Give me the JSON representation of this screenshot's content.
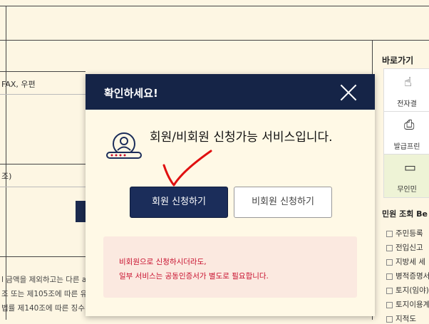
{
  "background": {
    "texts": [
      "FAX, 우편",
      "조)",
      "l 금액을 제외하고는 다른 a",
      "조 또는 제105조에 따른 유여",
      "법률 제140조에 따른 징수"
    ]
  },
  "right_panel": {
    "title": "바로가기",
    "items": [
      {
        "label": "전자결",
        "icon": "cursor-icon"
      },
      {
        "label": "발급프린",
        "icon": "printer-icon"
      },
      {
        "label": "무인민",
        "icon": "kiosk-icon"
      }
    ],
    "section_title": "민원 조회 Be",
    "list": [
      "주민등록",
      "전입신고",
      "지방세 세",
      "병적증명서",
      "토지(임야)",
      "토지이용계",
      "지적도"
    ]
  },
  "modal": {
    "title": "확인하세요!",
    "message": "회원/비회원 신청가능 서비스입니다.",
    "member_button": "회원 신청하기",
    "nonmember_button": "비회원 신청하기",
    "notice_line1": "비회원으로 신청하시더라도,",
    "notice_line2": "일부 서비스는 공동인증서가 별도로 필요합니다.",
    "colors": {
      "header": "#152447",
      "primary_button": "#1b2d5a",
      "notice_text": "#c8102e",
      "notice_bg": "#fbe9e0"
    }
  }
}
